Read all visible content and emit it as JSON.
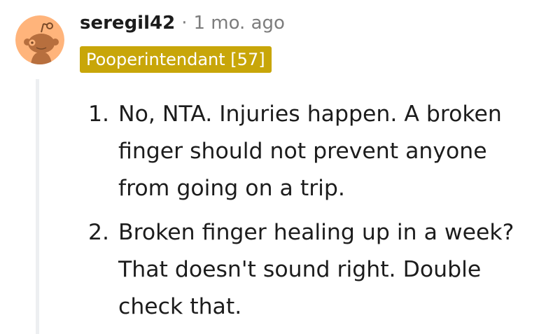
{
  "comment": {
    "author": {
      "username": "seregil42",
      "avatar_icon": "snoo-avatar-icon",
      "avatar_bg": "#ffb47b"
    },
    "separator": "·",
    "timestamp": "1 mo. ago",
    "flair": {
      "text": "Pooperintendant [57]",
      "bg_color": "#c8a609",
      "text_color": "#ffffff"
    },
    "body": {
      "list": [
        {
          "number": "1.",
          "text": "No, NTA. Injuries happen. A broken finger should not prevent anyone from going on a trip."
        },
        {
          "number": "2.",
          "text": "Broken finger healing up in a week? That doesn't sound right. Double check that."
        }
      ]
    }
  }
}
